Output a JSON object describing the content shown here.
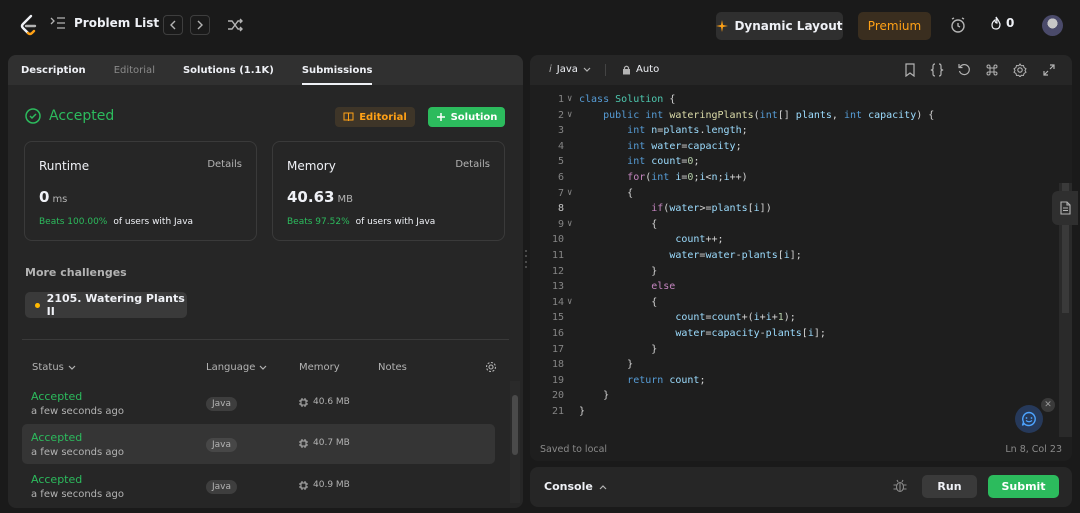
{
  "colors": {
    "accent_green": "#2cbb5d",
    "premium_orange": "#ffa116",
    "bg": "#1a1a1a",
    "panel": "#262626"
  },
  "topbar": {
    "problem_list": "Problem List",
    "dynamic_layout": "Dynamic Layout",
    "premium": "Premium",
    "streak_count": "0"
  },
  "left": {
    "tabs": [
      {
        "label": "Description"
      },
      {
        "label": "Editorial"
      },
      {
        "label": "Solutions (1.1K)"
      },
      {
        "label": "Submissions"
      }
    ],
    "status": "Accepted",
    "editorial_btn": "Editorial",
    "solution_btn": "Solution",
    "runtime": {
      "title": "Runtime",
      "details": "Details",
      "value": "0",
      "unit": "ms",
      "beats": "Beats 100.00%",
      "suffix": "of users with Java"
    },
    "memory": {
      "title": "Memory",
      "details": "Details",
      "value": "40.63",
      "unit": "MB",
      "beats": "Beats 97.52%",
      "suffix": "of users with Java"
    },
    "more_challenges": "More challenges",
    "challenge": "2105. Watering Plants II",
    "table": {
      "headers": {
        "status": "Status",
        "language": "Language",
        "memory": "Memory",
        "notes": "Notes"
      },
      "rows": [
        {
          "status": "Accepted",
          "time": "a few seconds ago",
          "lang": "Java",
          "memory": "40.6 MB"
        },
        {
          "status": "Accepted",
          "time": "a few seconds ago",
          "lang": "Java",
          "memory": "40.7 MB"
        },
        {
          "status": "Accepted",
          "time": "a few seconds ago",
          "lang": "Java",
          "memory": "40.9 MB"
        }
      ]
    }
  },
  "editor": {
    "language": "Java",
    "auto": "Auto",
    "saved": "Saved to local",
    "cursor": "Ln 8, Col 23",
    "lines": [
      "class Solution {",
      "    public int wateringPlants(int[] plants, int capacity) {",
      "        int n=plants.length;",
      "        int water=capacity;",
      "        int count=0;",
      "        for(int i=0;i<n;i++)",
      "        {",
      "            if(water>=plants[i])",
      "            {",
      "                count++;",
      "               water=water-plants[i];",
      "            }",
      "            else",
      "            {",
      "                count=count+(i+i+1);",
      "                water=capacity-plants[i];",
      "            }",
      "        }",
      "        return count;",
      "    }",
      "}"
    ]
  },
  "console": {
    "label": "Console",
    "run": "Run",
    "submit": "Submit"
  }
}
